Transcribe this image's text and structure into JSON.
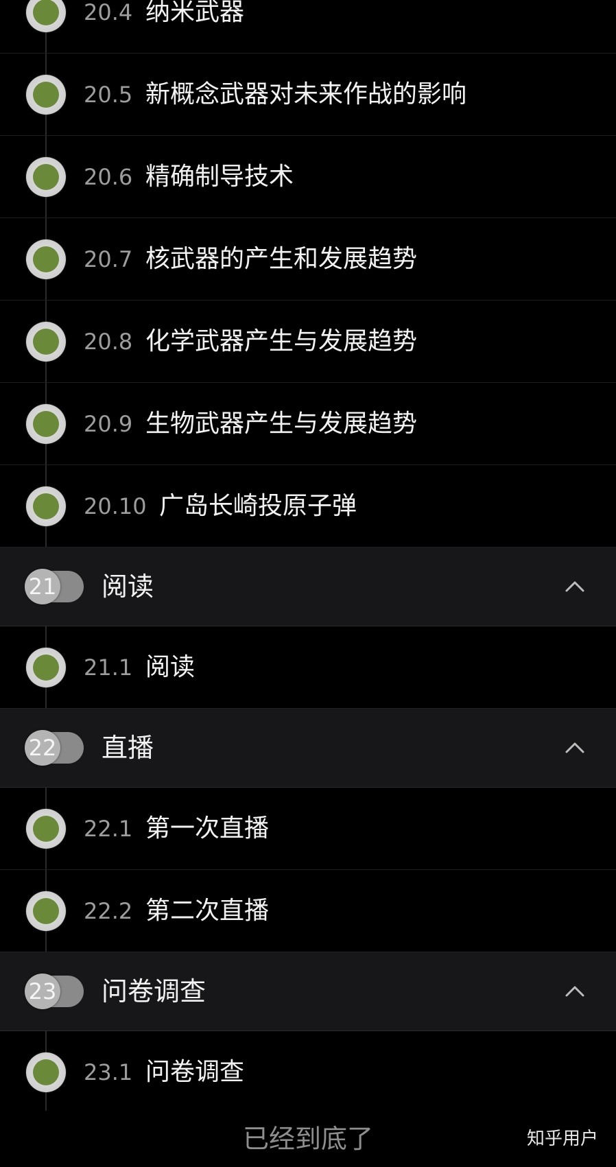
{
  "lessons_20": [
    {
      "number": "20.4",
      "title": "纳米武器"
    },
    {
      "number": "20.5",
      "title": "新概念武器对未来作战的影响"
    },
    {
      "number": "20.6",
      "title": "精确制导技术"
    },
    {
      "number": "20.7",
      "title": "核武器的产生和发展趋势"
    },
    {
      "number": "20.8",
      "title": "化学武器产生与发展趋势"
    },
    {
      "number": "20.9",
      "title": "生物武器产生与发展趋势"
    },
    {
      "number": "20.10",
      "title": "广岛长崎投原子弹"
    }
  ],
  "section_21": {
    "badge": "21",
    "title": "阅读",
    "toggle_icon": "chevron-up-icon"
  },
  "lessons_21": [
    {
      "number": "21.1",
      "title": "阅读"
    }
  ],
  "section_22": {
    "badge": "22",
    "title": "直播",
    "toggle_icon": "chevron-up-icon"
  },
  "lessons_22": [
    {
      "number": "22.1",
      "title": "第一次直播"
    },
    {
      "number": "22.2",
      "title": "第二次直播"
    }
  ],
  "section_23": {
    "badge": "23",
    "title": "问卷调查",
    "toggle_icon": "chevron-up-icon"
  },
  "lessons_23": [
    {
      "number": "23.1",
      "title": "问卷调查"
    }
  ],
  "footer": {
    "end_text": "已经到底了"
  },
  "watermark": "知乎用户",
  "colors": {
    "background": "#000000",
    "section_background": "#17171a",
    "dot_fill": "#6a8a3a",
    "accent": "#3d8fe0"
  }
}
